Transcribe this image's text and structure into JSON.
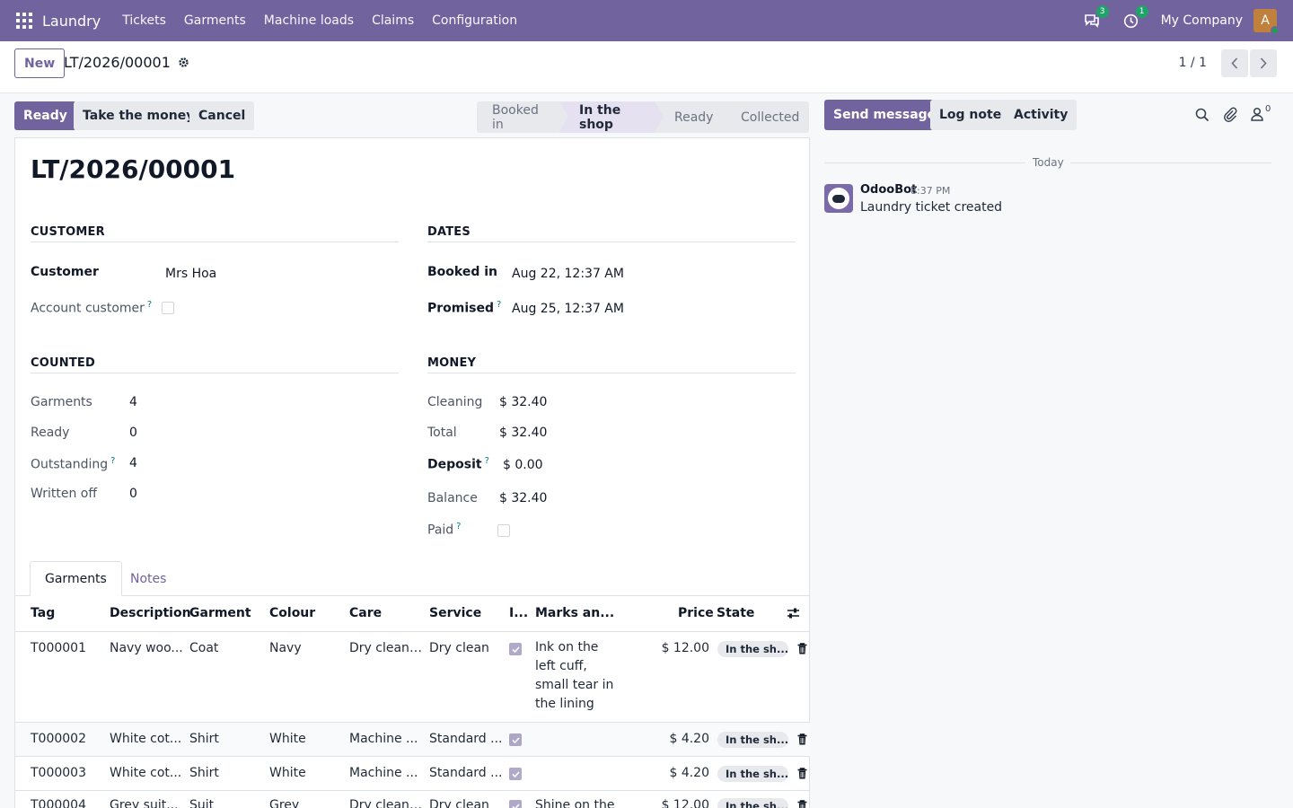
{
  "navbar": {
    "brand": "Laundry",
    "menu": [
      "Tickets",
      "Garments",
      "Machine loads",
      "Claims",
      "Configuration"
    ],
    "messages_count": "3",
    "activities_count": "1",
    "company": "My Company",
    "avatar_letter": "A"
  },
  "control": {
    "new_label": "New",
    "record_name": "LT/2026/00001",
    "pager": "1 / 1"
  },
  "actions": {
    "ready": "Ready",
    "take_money": "Take the money",
    "cancel": "Cancel"
  },
  "stages": [
    {
      "label": "Booked in",
      "active": false
    },
    {
      "label": "In the shop",
      "active": true
    },
    {
      "label": "Ready",
      "active": false
    },
    {
      "label": "Collected",
      "active": false
    }
  ],
  "form": {
    "title": "LT/2026/00001",
    "customer_group": {
      "title": "Customer",
      "customer_label": "Customer",
      "customer_value": "Mrs Hoa",
      "account_label": "Account customer",
      "account_checked": false
    },
    "dates_group": {
      "title": "Dates",
      "booked_label": "Booked in",
      "booked_value": "Aug 22, 12:37 AM",
      "promised_label": "Promised",
      "promised_value": "Aug 25, 12:37 AM"
    },
    "counted_group": {
      "title": "Counted",
      "garments_label": "Garments",
      "garments_value": "4",
      "ready_label": "Ready",
      "ready_value": "0",
      "outstanding_label": "Outstanding",
      "outstanding_value": "4",
      "written_off_label": "Written off",
      "written_off_value": "0"
    },
    "money_group": {
      "title": "Money",
      "cleaning_label": "Cleaning",
      "cleaning_value": "$ 32.40",
      "total_label": "Total",
      "total_value": "$ 32.40",
      "deposit_label": "Deposit",
      "deposit_value": "$ 0.00",
      "balance_label": "Balance",
      "balance_value": "$ 32.40",
      "paid_label": "Paid",
      "paid_checked": false
    },
    "help_mark": "?"
  },
  "notebook": {
    "tabs": [
      "Garments",
      "Notes"
    ]
  },
  "table": {
    "columns": [
      "Tag",
      "Description",
      "Garment",
      "Colour",
      "Care",
      "Service",
      "I...",
      "Marks an...",
      "Price",
      "State"
    ],
    "rows": [
      {
        "tag": "T000001",
        "description": "Navy woo...",
        "garment": "Coat",
        "colour": "Navy",
        "care": "Dry clean ...",
        "service": "Dry clean",
        "marks": "Ink on the left cuff, small tear in the lining",
        "price": "$ 12.00",
        "state": "In the sh..."
      },
      {
        "tag": "T000002",
        "description": "White cot...",
        "garment": "Shirt",
        "colour": "White",
        "care": "Machine ...",
        "service": "Standard ...",
        "marks": "",
        "price": "$ 4.20",
        "state": "In the sh..."
      },
      {
        "tag": "T000003",
        "description": "White cot...",
        "garment": "Shirt",
        "colour": "White",
        "care": "Machine ...",
        "service": "Standard ...",
        "marks": "",
        "price": "$ 4.20",
        "state": "In the sh..."
      },
      {
        "tag": "T000004",
        "description": "Grey suit...",
        "garment": "Suit",
        "colour": "Grey",
        "care": "Dry clean ...",
        "service": "Dry clean",
        "marks": "Shine on the",
        "price": "$ 12.00",
        "state": "In the sh..."
      }
    ]
  },
  "chatter": {
    "send_message": "Send message",
    "log_note": "Log note",
    "activity": "Activity",
    "followers_count": "0",
    "today_label": "Today",
    "message": {
      "author": "OdooBot",
      "time": "8:37 PM",
      "body": "Laundry ticket created"
    }
  },
  "colors": {
    "brand": "#71639e",
    "success": "#20a36a"
  }
}
